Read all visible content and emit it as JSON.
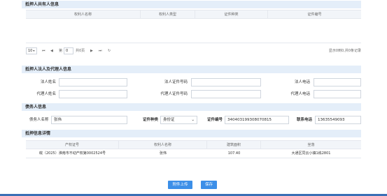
{
  "mortgagee_section": {
    "title": "抵押人共有人信息",
    "columns": [
      "权利人名称",
      "权利人类型",
      "证件种类",
      "证件编号"
    ],
    "pager": {
      "page_size": "10",
      "page_prefix": "第",
      "page_value": "0",
      "page_suffix": "共0页",
      "summary": "显示0到0,共0条记录"
    }
  },
  "legal_section": {
    "title": "抵押人法人及代理人信息",
    "fields": {
      "legal_name_label": "法人姓名",
      "legal_id_label": "法人证件号码",
      "legal_phone_label": "法人电话",
      "agent_name_label": "代理人姓名",
      "agent_id_label": "代理人证件号码",
      "agent_phone_label": "代理人电话"
    }
  },
  "debtor_section": {
    "title": "债务人信息",
    "name_label": "债务人名称",
    "name_value": "张伟",
    "id_type_label": "证件种类",
    "id_type_value": "身份证",
    "id_no_label": "证件编号",
    "id_no_value": "340403199308070815",
    "phone_label": "联系电话",
    "phone_value": "13635549093"
  },
  "detail_section": {
    "title": "抵押信息详情",
    "columns": [
      "产权证号",
      "权利人名称",
      "建筑面积",
      "坐落"
    ],
    "rows": [
      [
        "皖（2025）淮南市不动产权第0002524号",
        "张伟",
        "107.40",
        "大通区同云小镇1栋2801"
      ]
    ]
  },
  "buttons": {
    "upload": "附件上传",
    "save": "保存"
  }
}
